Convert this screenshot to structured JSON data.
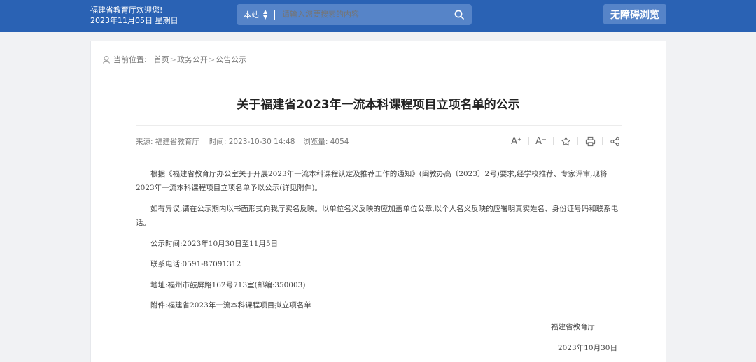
{
  "header": {
    "welcome": "福建省教育厅欢迎您!",
    "date": "2023年11月05日 星期日",
    "search_scope": "本站",
    "search_placeholder": "请输入您要搜索的内容",
    "accessible_label": "无障碍浏览"
  },
  "breadcrumb": {
    "label": "当前位置:",
    "items": [
      "首页",
      "政务公开",
      "公告公示"
    ]
  },
  "article": {
    "title": "关于福建省2023年一流本科课程项目立项名单的公示",
    "meta": {
      "source": "来源: 福建省教育厅",
      "time": "时间: 2023-10-30 14:48",
      "views": "浏览量: 4054"
    },
    "paragraphs": [
      "根据《福建省教育厅办公室关于开展2023年一流本科课程认定及推荐工作的通知》(闽教办高〔2023〕2号)要求,经学校推荐、专家评审,现将2023年一流本科课程项目立项名单予以公示(详见附件)。",
      "如有异议,请在公示期内以书面形式向我厅实名反映。以单位名义反映的应加盖单位公章,以个人名义反映的应署明真实姓名、身份证号码和联系电话。"
    ],
    "lines": [
      "公示时间:2023年10月30日至11月5日",
      "联系电话:0591-87091312",
      "地址:福州市鼓屏路162号713室(邮编:350003)",
      "附件:福建省2023年一流本科课程项目拟立项名单"
    ],
    "signature": "福建省教育厅",
    "sign_date": "2023年10月30日"
  },
  "tools": {
    "font_increase": "A⁺",
    "font_decrease": "A⁻"
  },
  "icons": [
    "search-icon",
    "location-icon",
    "star-icon",
    "print-icon",
    "share-icon"
  ],
  "colors": {
    "header_bg": "#2a62b4",
    "search_bg": "#5684c8"
  }
}
